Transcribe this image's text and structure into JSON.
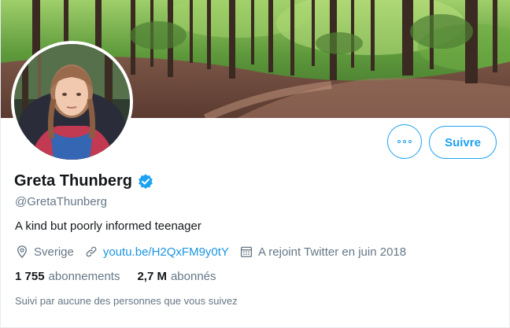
{
  "profile": {
    "name": "Greta Thunberg",
    "handle": "@GretaThunberg",
    "bio": "A kind but poorly informed teenager",
    "location": "Sverige",
    "website": "youtu.be/H2QxFM9y0tY",
    "joined": "A rejoint Twitter en juin 2018",
    "following_count": "1 755",
    "following_label": "abonnements",
    "followers_count": "2,7 M",
    "followers_label": "abonnés",
    "followed_by": "Suivi par aucune des personnes que vous suivez"
  },
  "actions": {
    "more_icon": "more-dots-icon",
    "follow_label": "Suivre"
  },
  "icons": {
    "verified": "verified-badge-icon",
    "location": "location-pin-icon",
    "link": "link-icon",
    "calendar": "calendar-icon"
  },
  "colors": {
    "accent": "#1da1f2",
    "link": "#1b95e0",
    "secondary_text": "#657786",
    "primary_text": "#14171a"
  }
}
